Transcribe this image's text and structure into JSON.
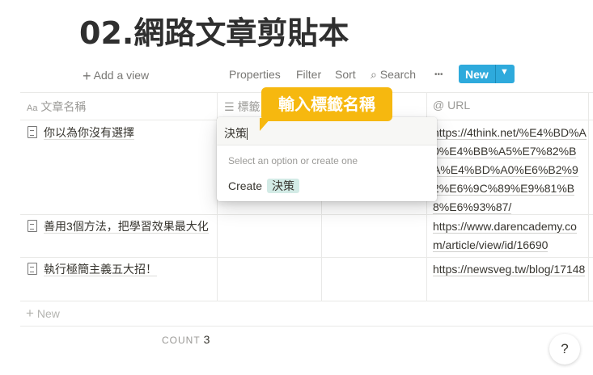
{
  "page_title": "02.網路文章剪貼本",
  "toolbar": {
    "add_view": "Add a view",
    "properties": "Properties",
    "filter": "Filter",
    "sort": "Sort",
    "search": "Search",
    "more": "•••",
    "new": "New"
  },
  "columns": {
    "name": "文章名稱",
    "tags": "標籤",
    "url": "URL"
  },
  "rows": [
    {
      "name": "你以為你沒有選擇",
      "url": "https://4think.net/%E4%BD%A0%E4%BB%A5%E7%82%BA%E4%BD%A0%E6%B2%92%E6%9C%89%E9%81%B8%E6%93%87/"
    },
    {
      "name": "善用3個方法，把學習效果最大化",
      "url": "https://www.darencademy.com/article/view/id/16690"
    },
    {
      "name": "執行極簡主義五大招！",
      "url": "https://newsveg.tw/blog/17148"
    }
  ],
  "new_row": "New",
  "footer": {
    "count_label": "COUNT",
    "count_value": "3"
  },
  "popup": {
    "input_value": "決策",
    "hint": "Select an option or create one",
    "create_label": "Create",
    "create_tag": "決策"
  },
  "callout": "輸入標籤名稱",
  "help": "?",
  "colors": {
    "accent": "#2eaadc",
    "callout": "#f6b80f",
    "tag": "#d3ebe6"
  }
}
